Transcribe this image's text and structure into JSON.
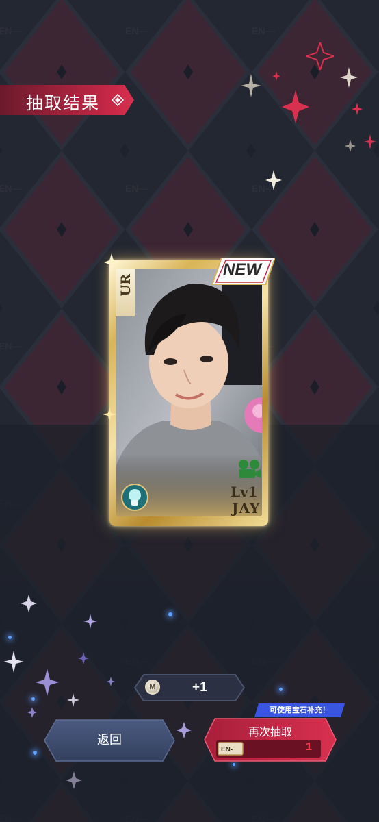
{
  "header": {
    "title": "抽取结果"
  },
  "card": {
    "rarity": "UR",
    "new_badge": "NEW",
    "level": "Lv1",
    "member": "JAY",
    "watermark": "EN-"
  },
  "reward": {
    "currency_icon": "M",
    "amount": "+1"
  },
  "actions": {
    "back_label": "返回",
    "redraw_label": "再次抽取",
    "redraw_hint": "可使用宝石补充！",
    "ticket_label": "EN-",
    "ticket_count": "1"
  },
  "colors": {
    "accent_red": "#c42745",
    "background": "#232834",
    "card_gold": "#d9b458",
    "back_button": "#3e4d70"
  }
}
